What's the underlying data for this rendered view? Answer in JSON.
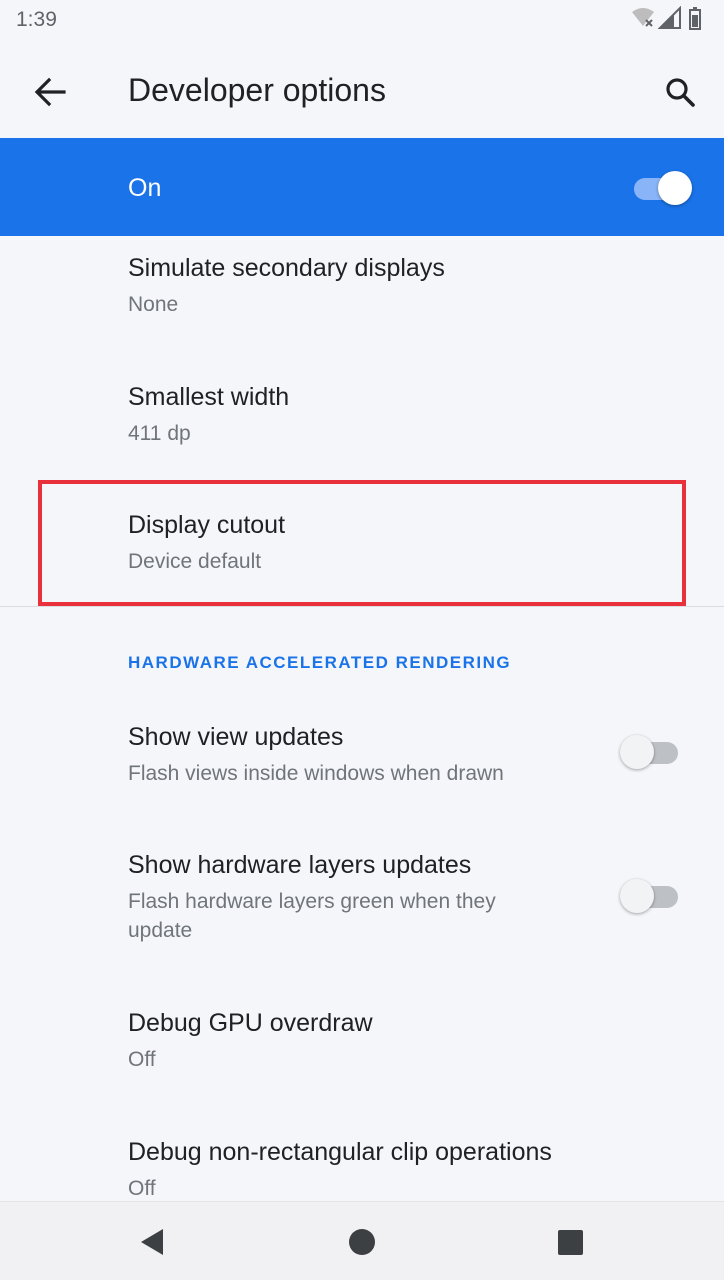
{
  "status_bar": {
    "time": "1:39",
    "icons": [
      "wifi-off-icon",
      "cell-signal-icon",
      "battery-icon"
    ]
  },
  "app_bar": {
    "title": "Developer options",
    "back_icon": "arrow-back-icon",
    "search_icon": "search-icon"
  },
  "master_switch": {
    "label": "On",
    "state": "on",
    "accent_color": "#1a73e8"
  },
  "preferences": [
    {
      "title": "Simulate secondary displays",
      "summary": "None"
    },
    {
      "title": "Smallest width",
      "summary": "411 dp"
    },
    {
      "title": "Display cutout",
      "summary": "Device default",
      "highlighted": true
    }
  ],
  "section": {
    "header": "HARDWARE ACCELERATED RENDERING",
    "items": [
      {
        "title": "Show view updates",
        "summary": "Flash views inside windows when drawn",
        "toggle": "off"
      },
      {
        "title": "Show hardware layers updates",
        "summary_line1": "Flash hardware layers green when they",
        "summary_line2": "update",
        "toggle": "off"
      },
      {
        "title": "Debug GPU overdraw",
        "summary": "Off"
      },
      {
        "title": "Debug non-rectangular clip operations",
        "summary": "Off"
      }
    ]
  },
  "nav_bar": {
    "icons": [
      "nav-back-icon",
      "nav-home-icon",
      "nav-recents-icon"
    ]
  },
  "colors": {
    "highlight": "#e8313b",
    "background": "#f5f6fa"
  }
}
